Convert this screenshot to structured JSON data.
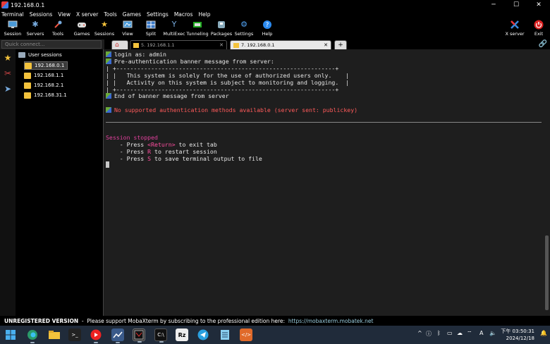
{
  "window": {
    "title": "192.168.0.1",
    "minimize": "─",
    "maximize": "☐",
    "close": "✕"
  },
  "menu": [
    "Terminal",
    "Sessions",
    "View",
    "X server",
    "Tools",
    "Games",
    "Settings",
    "Macros",
    "Help"
  ],
  "toolbar": {
    "session": "Session",
    "servers": "Servers",
    "tools": "Tools",
    "games": "Games",
    "sessions": "Sessions",
    "view": "View",
    "split": "Split",
    "multiexec": "MultiExec",
    "tunneling": "Tunneling",
    "packages": "Packages",
    "settings": "Settings",
    "help": "Help",
    "xserver": "X server",
    "exit": "Exit"
  },
  "quickconnect": {
    "placeholder": "Quick connect..."
  },
  "tabs": [
    {
      "label": "5. 192.168.1.1"
    },
    {
      "label": "7. 192.168.0.1"
    }
  ],
  "sessions": {
    "root": "User sessions",
    "items": [
      "192.168.0.1",
      "192.168.1.1",
      "192.168.2.1",
      "192.168.31.1"
    ]
  },
  "terminal": {
    "login": "login as: admin",
    "pre_banner": "Pre-authentication banner message from server:",
    "border_top": "| +---------------------------------------------------------------+",
    "line1": "| |   This system is solely for the use of authorized users only.    |",
    "line2": "| |   Activity on this system is subject to monitoring and logging.  |",
    "border_bottom": "| +---------------------------------------------------------------+",
    "end_banner": "End of banner message from server",
    "error": "No supported authentication methods available (server sent: publickey)",
    "stopped": "Session stopped",
    "opt1_pre": "    - Press ",
    "opt1_key": "<Return>",
    "opt1_post": " to exit tab",
    "opt2_pre": "    - Press ",
    "opt2_key": "R",
    "opt2_post": " to restart session",
    "opt3_pre": "    - Press ",
    "opt3_key": "S",
    "opt3_post": " to save terminal output to file"
  },
  "status": {
    "label": "UNREGISTERED VERSION",
    "message": "  -  Please support MobaXterm by subscribing to the professional edition here:  ",
    "link": "https://mobaxterm.mobatek.net"
  },
  "taskbar": {
    "time": "下午 03:50:31",
    "date": "2024/12/18",
    "lang": "A"
  },
  "colors": {
    "error": "#ff5a5a",
    "stopped": "#e0409c",
    "key": "#ff4fa0",
    "accent": "#f3c23c"
  }
}
